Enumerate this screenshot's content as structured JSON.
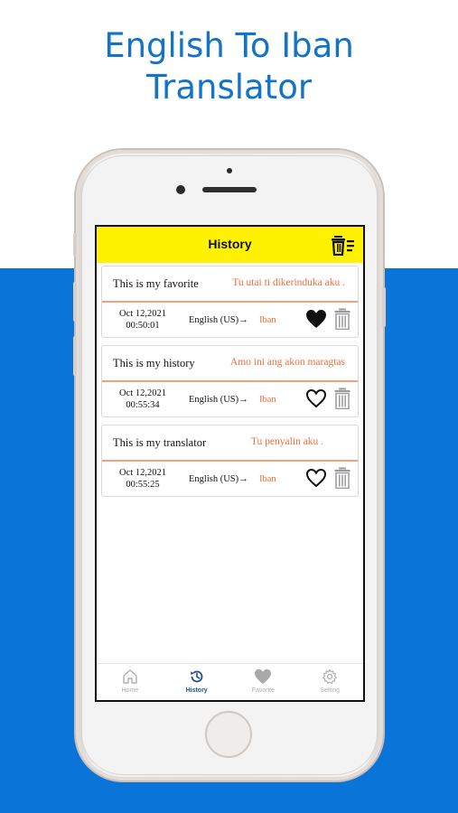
{
  "promo": {
    "title_line1": "English To Iban",
    "title_line2": "Translator"
  },
  "colors": {
    "accent_blue": "#0b74d8",
    "header_yellow": "#fff200",
    "target_orange": "#ee6d3a",
    "active_tab": "#1f4f8c"
  },
  "app": {
    "header": {
      "title": "History",
      "clear_icon": "clear-list-icon"
    },
    "history": [
      {
        "source": "This is my favorite",
        "target": "Tu utai ti dikerinduka aku .",
        "date": "Oct 12,2021",
        "time": "00:50:01",
        "from_lang": "English (US)",
        "to_lang": "Iban",
        "favorited": true
      },
      {
        "source": "This is my history",
        "target": "Amo ini ang akon maragtas",
        "date": "Oct 12,2021",
        "time": "00:55:34",
        "from_lang": "English (US)",
        "to_lang": "Iban",
        "favorited": false
      },
      {
        "source": "This is my translator",
        "target": "Tu penyalin aku .",
        "date": "Oct 12,2021",
        "time": "00:55:25",
        "from_lang": "English (US)",
        "to_lang": "Iban",
        "favorited": false
      }
    ],
    "arrow": "→",
    "tabs": [
      {
        "label": "Home",
        "icon": "home-icon",
        "active": false
      },
      {
        "label": "History",
        "icon": "history-icon",
        "active": true
      },
      {
        "label": "Favorite",
        "icon": "heart-icon",
        "active": false
      },
      {
        "label": "Setting",
        "icon": "gear-icon",
        "active": false
      }
    ]
  }
}
